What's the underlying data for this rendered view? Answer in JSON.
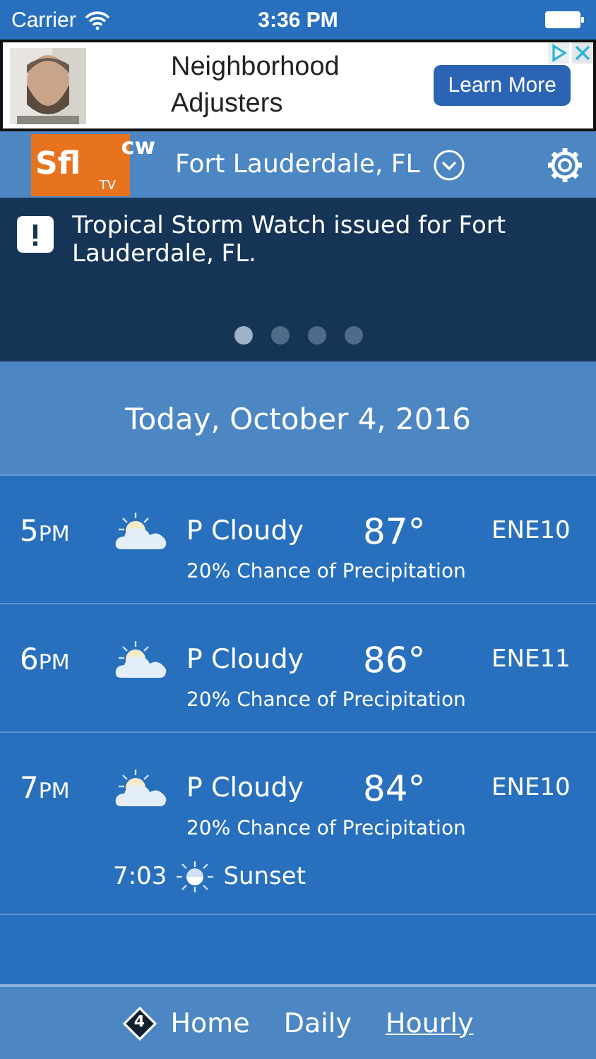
{
  "status_bar": {
    "carrier": "Carrier",
    "time": "3:36 PM"
  },
  "ad": {
    "headline": "Neighborhood Adjusters",
    "button": "Learn More"
  },
  "header": {
    "logo": {
      "main": "Sfl",
      "network": "cw",
      "sub": "TV"
    },
    "location": "Fort Lauderdale, FL"
  },
  "alert": {
    "text": "Tropical Storm Watch issued for Fort Lauderdale, FL.",
    "pages": [
      {
        "selected": true
      },
      {
        "selected": false
      },
      {
        "selected": false
      },
      {
        "selected": false
      }
    ]
  },
  "date": "Today, October 4, 2016",
  "hours": [
    {
      "hour": "5",
      "period": "PM",
      "condition": "P Cloudy",
      "temp": "87°",
      "wind": "ENE10",
      "precip": "20% Chance of Precipitation"
    },
    {
      "hour": "6",
      "period": "PM",
      "condition": "P Cloudy",
      "temp": "86°",
      "wind": "ENE11",
      "precip": "20% Chance of Precipitation"
    },
    {
      "hour": "7",
      "period": "PM",
      "condition": "P Cloudy",
      "temp": "84°",
      "wind": "ENE10",
      "precip": "20% Chance of Precipitation",
      "event": {
        "time": "7:03",
        "label": "Sunset"
      }
    }
  ],
  "nav": {
    "badge": "4",
    "items": [
      {
        "label": "Home",
        "selected": false
      },
      {
        "label": "Daily",
        "selected": false
      },
      {
        "label": "Hourly",
        "selected": true
      }
    ]
  }
}
